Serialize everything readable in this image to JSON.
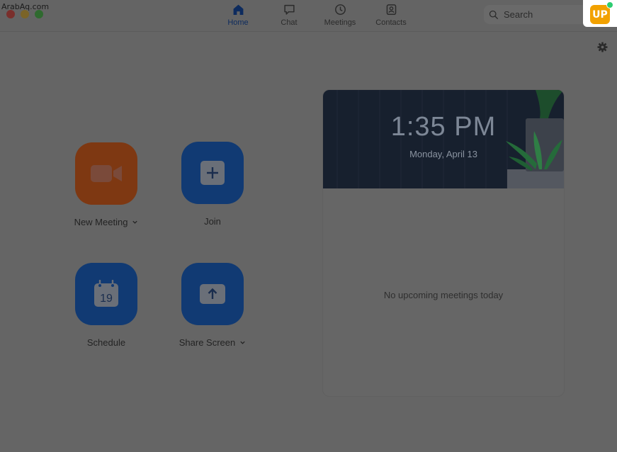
{
  "watermark": "ArabAq.com",
  "nav": {
    "items": [
      {
        "label": "Home",
        "icon": "home-icon",
        "active": true
      },
      {
        "label": "Chat",
        "icon": "chat-icon",
        "active": false
      },
      {
        "label": "Meetings",
        "icon": "clock-icon",
        "active": false
      },
      {
        "label": "Contacts",
        "icon": "contacts-icon",
        "active": false
      }
    ]
  },
  "search": {
    "placeholder": "Search"
  },
  "avatar": {
    "initials": "UP",
    "status_color": "#2ecc71",
    "color": "#f2a100"
  },
  "actions": [
    {
      "label": "New Meeting",
      "icon": "video-camera-icon",
      "color": "#7e3812",
      "has_dropdown": true
    },
    {
      "label": "Join",
      "icon": "plus-icon",
      "color": "#113a73",
      "has_dropdown": false
    },
    {
      "label": "Schedule",
      "icon": "calendar-icon",
      "calendar_day": "19",
      "color": "#113a73",
      "has_dropdown": false
    },
    {
      "label": "Share Screen",
      "icon": "share-up-arrow-icon",
      "color": "#113a73",
      "has_dropdown": true
    }
  ],
  "upcoming": {
    "time": "1:35 PM",
    "date": "Monday, April 13",
    "empty_message": "No upcoming meetings today"
  }
}
